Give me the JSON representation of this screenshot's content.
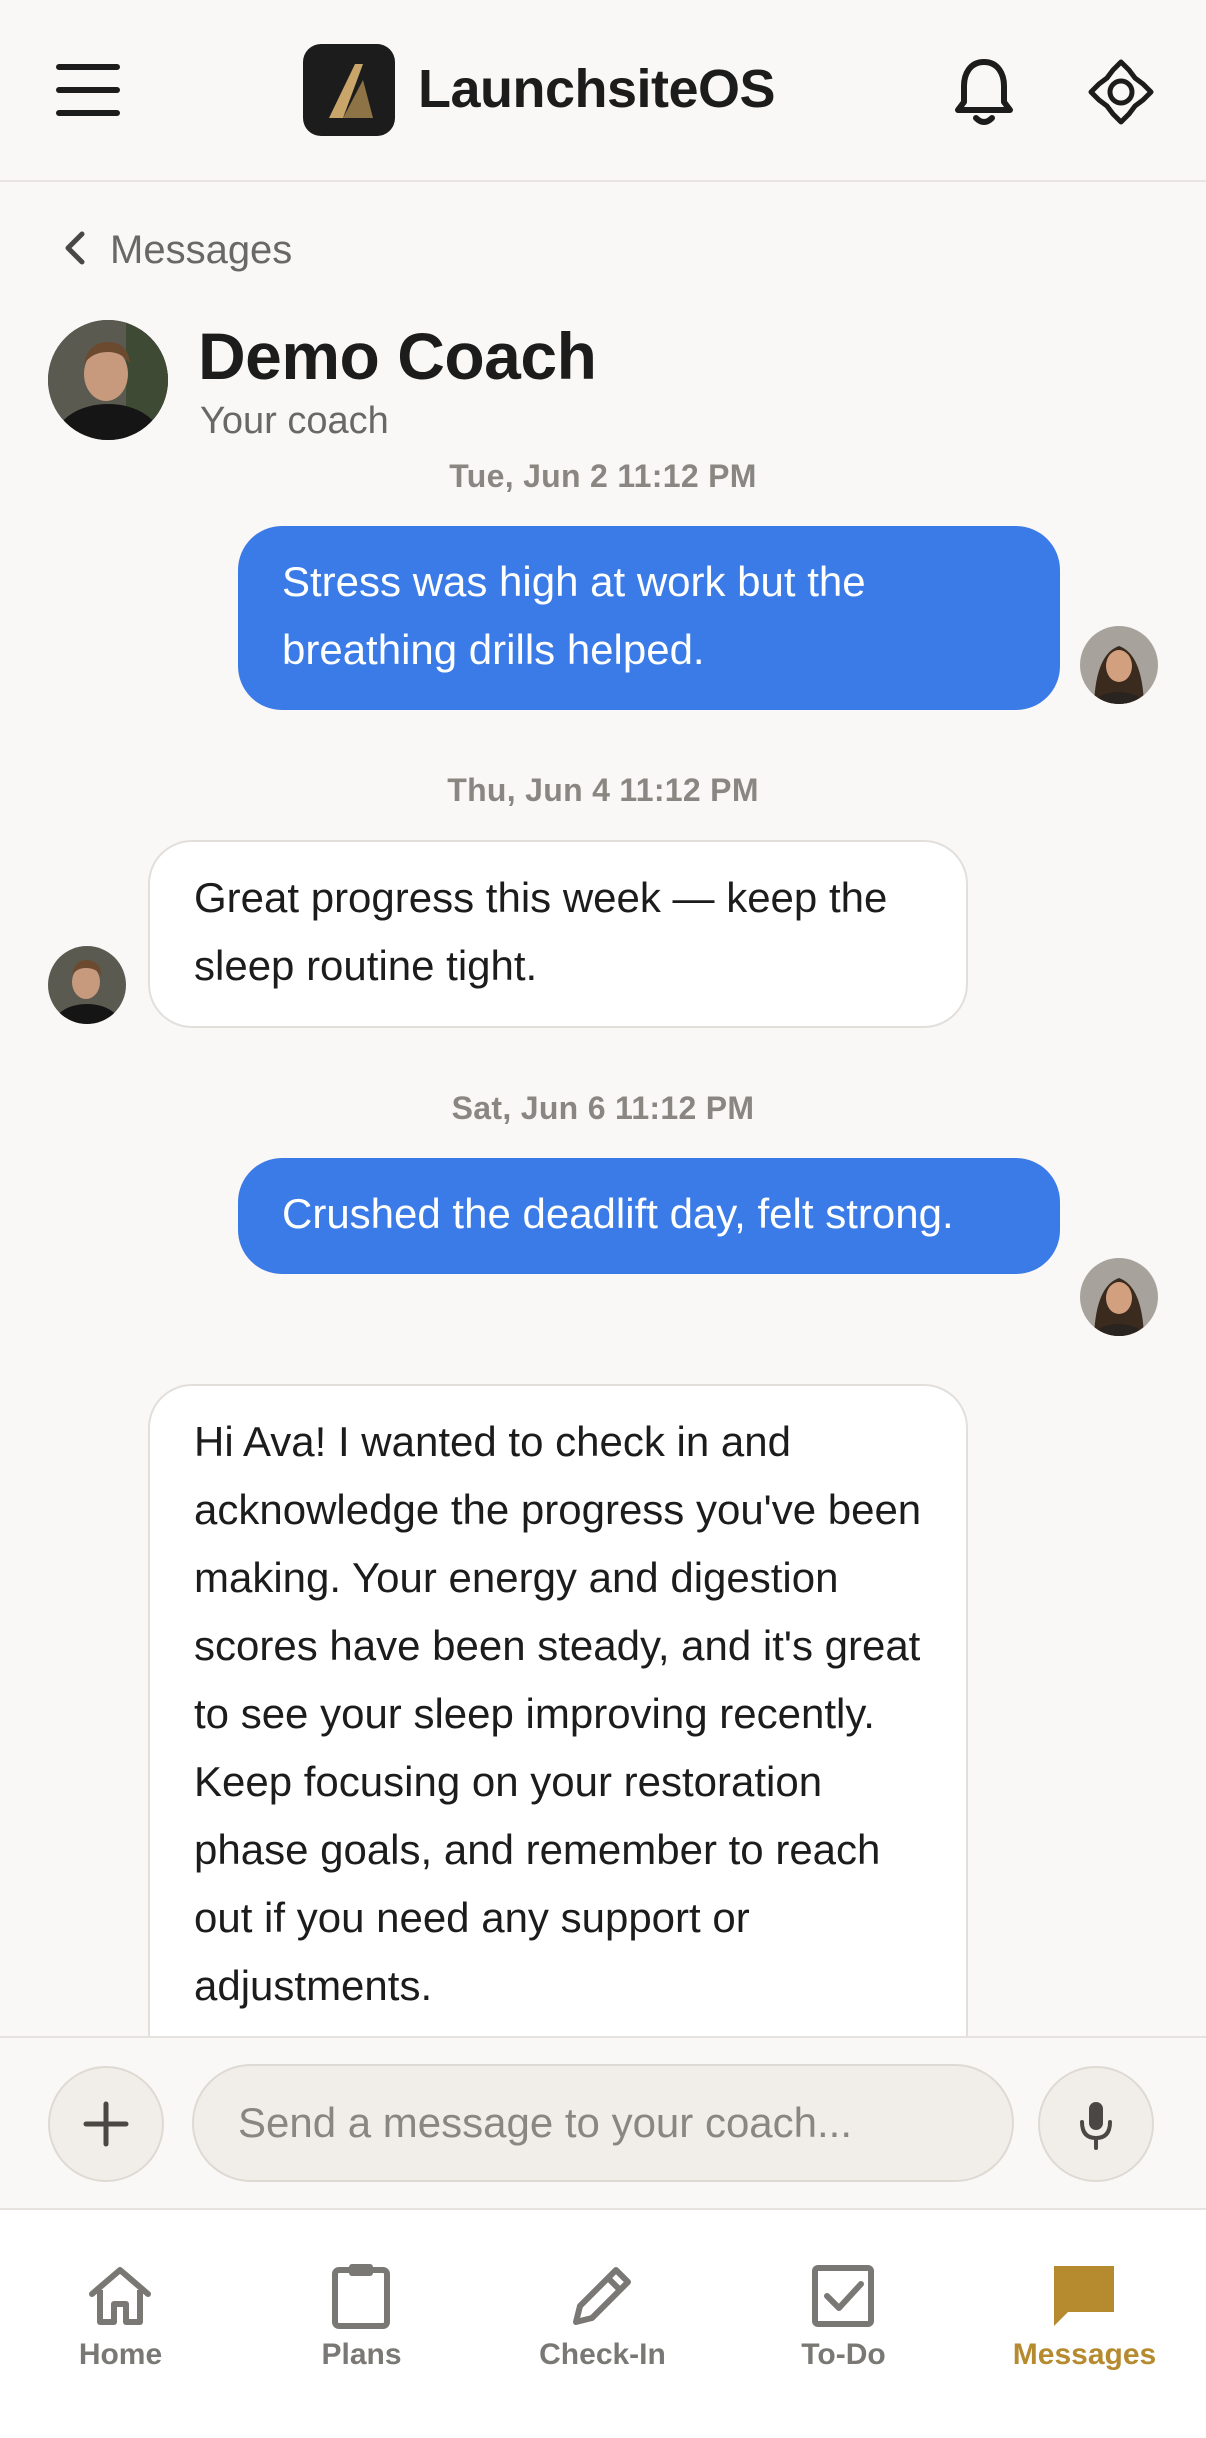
{
  "header": {
    "app_title": "LaunchsiteOS",
    "icons": {
      "menu": "hamburger-menu-icon",
      "logo": "launchsite-logo",
      "notifications": "bell-icon",
      "theme": "sun-theme-icon"
    }
  },
  "conversation": {
    "back_label": "Messages",
    "coach_name": "Demo Coach",
    "coach_role": "Your coach"
  },
  "messages": [
    {
      "timestamp": "Tue, Jun 2 11:12 PM",
      "direction": "outgoing",
      "text": "Stress was high at work but the breathing drills helped."
    },
    {
      "timestamp": "Thu, Jun 4 11:12 PM",
      "direction": "incoming",
      "text": "Great progress this week — keep the sleep routine tight."
    },
    {
      "timestamp": "Sat, Jun 6 11:12 PM",
      "direction": "outgoing",
      "text": "Crushed the deadlift day, felt strong."
    },
    {
      "timestamp": "",
      "direction": "incoming",
      "text": "Hi Ava! I wanted to check in and acknowledge the progress you've been making. Your energy and digestion scores have been steady, and it's great to see your sleep improving recently. Keep focusing on your restoration phase goals, and remember to reach out if you need any support or adjustments."
    }
  ],
  "composer": {
    "placeholder": "Send a message to your coach...",
    "value": "",
    "icons": {
      "add": "plus-icon",
      "voice": "microphone-icon"
    }
  },
  "tabs": [
    {
      "label": "Home",
      "icon": "home-icon",
      "active": false
    },
    {
      "label": "Plans",
      "icon": "clipboard-icon",
      "active": false
    },
    {
      "label": "Check-In",
      "icon": "pencil-icon",
      "active": false
    },
    {
      "label": "To-Do",
      "icon": "checkbox-icon",
      "active": false
    },
    {
      "label": "Messages",
      "icon": "chat-bubble-icon",
      "active": true
    }
  ],
  "colors": {
    "accent": "#b68a2e",
    "outgoing_bubble": "#3b7be8",
    "background": "#f9f8f6"
  }
}
